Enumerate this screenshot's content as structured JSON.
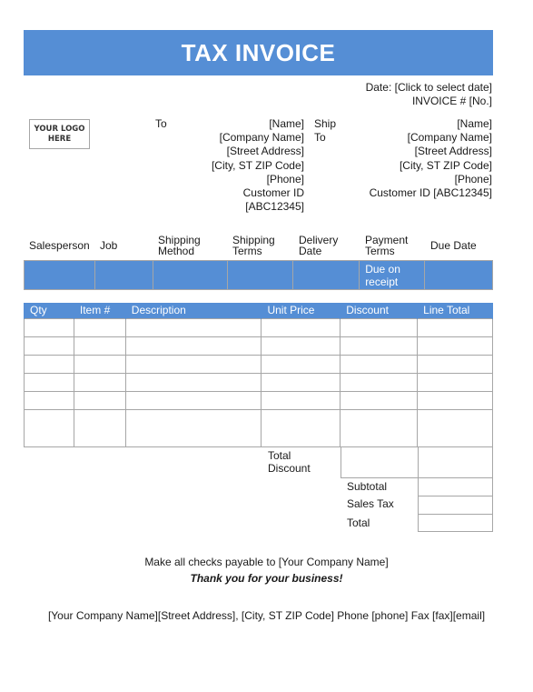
{
  "header": {
    "title": "TAX INVOICE",
    "date_line": "Date: [Click to select date]",
    "invoice_line": "INVOICE # [No.]"
  },
  "logo": {
    "line1": "YOUR LOGO",
    "line2": "HERE"
  },
  "bill_to": {
    "label": "To",
    "lines": [
      "[Name]",
      "[Company Name]",
      "[Street Address]",
      "[City, ST  ZIP Code]",
      "[Phone]",
      "Customer ID",
      "[ABC12345]"
    ]
  },
  "ship_to": {
    "label_line1": "Ship",
    "label_line2": "To",
    "lines": [
      "[Name]",
      "[Company Name]",
      "[Street Address]",
      "[City, ST  ZIP Code]",
      "[Phone]",
      "Customer ID [ABC12345]"
    ]
  },
  "order_info": {
    "columns": [
      "Salesperson",
      "Job",
      "Shipping Method",
      "Shipping Terms",
      "Delivery Date",
      "Payment Terms",
      "Due Date"
    ],
    "values": [
      "",
      "",
      "",
      "",
      "",
      "Due on receipt",
      ""
    ]
  },
  "items": {
    "columns": [
      "Qty",
      "Item #",
      "Description",
      "Unit Price",
      "Discount",
      "Line Total"
    ],
    "rows": [
      [
        "",
        "",
        "",
        "",
        "",
        ""
      ],
      [
        "",
        "",
        "",
        "",
        "",
        ""
      ],
      [
        "",
        "",
        "",
        "",
        "",
        ""
      ],
      [
        "",
        "",
        "",
        "",
        "",
        ""
      ],
      [
        "",
        "",
        "",
        "",
        "",
        ""
      ],
      [
        "",
        "",
        "",
        "",
        "",
        ""
      ]
    ]
  },
  "totals": {
    "total_discount_label_1": "Total",
    "total_discount_label_2": "Discount",
    "subtotal_label": "Subtotal",
    "sales_tax_label": "Sales Tax",
    "total_label": "Total",
    "total_discount_value": "",
    "total_discount_line_value": "",
    "subtotal_value": "",
    "sales_tax_value": "",
    "total_value": ""
  },
  "footer": {
    "payable": "Make all checks payable to [Your Company Name]",
    "thanks": "Thank you for your business!",
    "contact": "[Your Company Name][Street Address], [City, ST  ZIP Code]  Phone [phone]  Fax [fax][email]"
  },
  "colors": {
    "accent": "#558ed5",
    "border": "#a6a6a6"
  }
}
